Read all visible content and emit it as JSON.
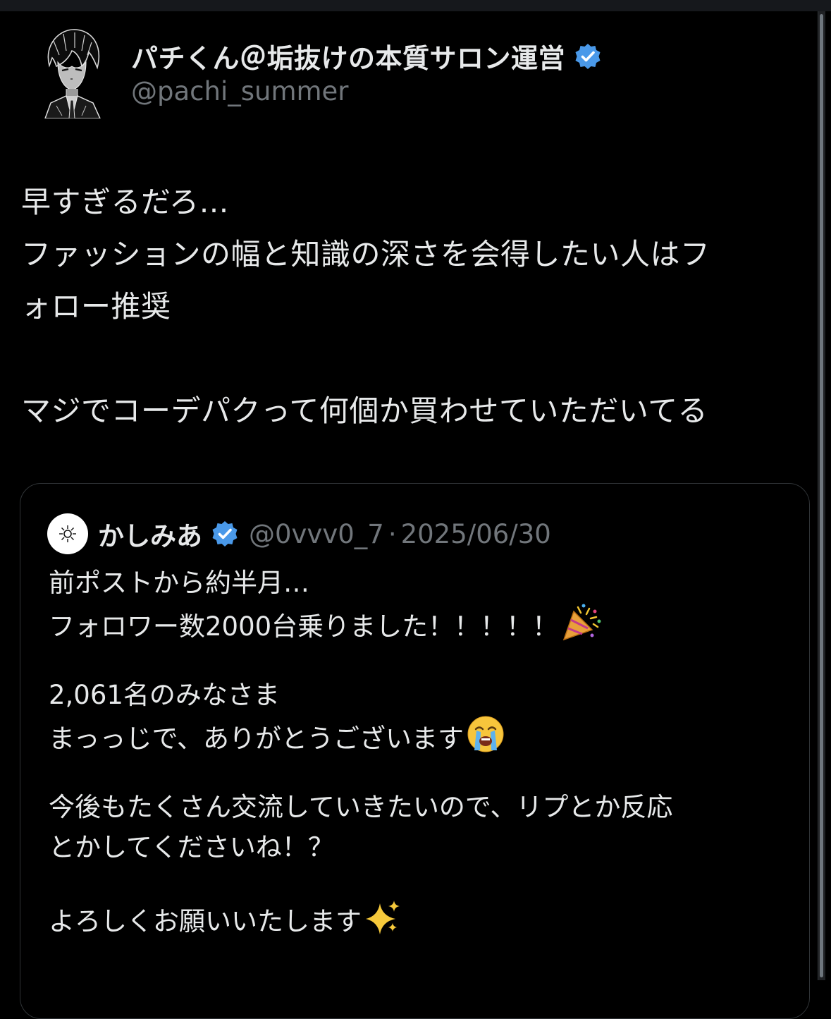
{
  "post": {
    "author_name": "パチくん＠垢抜けの本質サロン運営",
    "handle": "@pachi_summer",
    "verified_color": "#4a99e9",
    "body_lines": [
      "早すぎるだろ…",
      "ファッションの幅と知識の深さを会得したい人はフ",
      "ォロー推奨",
      "",
      "マジでコーデパクって何個か買わせていただいてる"
    ]
  },
  "quote": {
    "author_name": "かしみあ",
    "handle": "@0vvv0_7",
    "separator": "·",
    "date": "2025/06/30",
    "lines": {
      "l1": "前ポストから約半月…",
      "l2": "フォロワー数2000台乗りました！！！！！",
      "l3": "2,061名のみなさま",
      "l4": "まっっじで、ありがとうございます",
      "l5": "今後もたくさん交流していきたいので、リプとか反応",
      "l6": "とかしてくださいね！？",
      "l7": "よろしくお願いいたします"
    },
    "emojis": [
      "party-popper-icon",
      "crying-face-icon",
      "sparkles-icon"
    ]
  }
}
